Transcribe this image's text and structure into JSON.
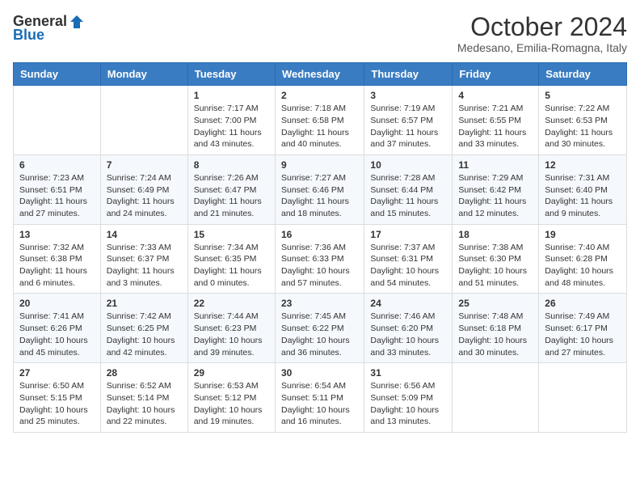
{
  "header": {
    "logo_general": "General",
    "logo_blue": "Blue",
    "month_title": "October 2024",
    "location": "Medesano, Emilia-Romagna, Italy"
  },
  "weekdays": [
    "Sunday",
    "Monday",
    "Tuesday",
    "Wednesday",
    "Thursday",
    "Friday",
    "Saturday"
  ],
  "weeks": [
    [
      {
        "day": "",
        "content": ""
      },
      {
        "day": "",
        "content": ""
      },
      {
        "day": "1",
        "content": "Sunrise: 7:17 AM\nSunset: 7:00 PM\nDaylight: 11 hours and 43 minutes."
      },
      {
        "day": "2",
        "content": "Sunrise: 7:18 AM\nSunset: 6:58 PM\nDaylight: 11 hours and 40 minutes."
      },
      {
        "day": "3",
        "content": "Sunrise: 7:19 AM\nSunset: 6:57 PM\nDaylight: 11 hours and 37 minutes."
      },
      {
        "day": "4",
        "content": "Sunrise: 7:21 AM\nSunset: 6:55 PM\nDaylight: 11 hours and 33 minutes."
      },
      {
        "day": "5",
        "content": "Sunrise: 7:22 AM\nSunset: 6:53 PM\nDaylight: 11 hours and 30 minutes."
      }
    ],
    [
      {
        "day": "6",
        "content": "Sunrise: 7:23 AM\nSunset: 6:51 PM\nDaylight: 11 hours and 27 minutes."
      },
      {
        "day": "7",
        "content": "Sunrise: 7:24 AM\nSunset: 6:49 PM\nDaylight: 11 hours and 24 minutes."
      },
      {
        "day": "8",
        "content": "Sunrise: 7:26 AM\nSunset: 6:47 PM\nDaylight: 11 hours and 21 minutes."
      },
      {
        "day": "9",
        "content": "Sunrise: 7:27 AM\nSunset: 6:46 PM\nDaylight: 11 hours and 18 minutes."
      },
      {
        "day": "10",
        "content": "Sunrise: 7:28 AM\nSunset: 6:44 PM\nDaylight: 11 hours and 15 minutes."
      },
      {
        "day": "11",
        "content": "Sunrise: 7:29 AM\nSunset: 6:42 PM\nDaylight: 11 hours and 12 minutes."
      },
      {
        "day": "12",
        "content": "Sunrise: 7:31 AM\nSunset: 6:40 PM\nDaylight: 11 hours and 9 minutes."
      }
    ],
    [
      {
        "day": "13",
        "content": "Sunrise: 7:32 AM\nSunset: 6:38 PM\nDaylight: 11 hours and 6 minutes."
      },
      {
        "day": "14",
        "content": "Sunrise: 7:33 AM\nSunset: 6:37 PM\nDaylight: 11 hours and 3 minutes."
      },
      {
        "day": "15",
        "content": "Sunrise: 7:34 AM\nSunset: 6:35 PM\nDaylight: 11 hours and 0 minutes."
      },
      {
        "day": "16",
        "content": "Sunrise: 7:36 AM\nSunset: 6:33 PM\nDaylight: 10 hours and 57 minutes."
      },
      {
        "day": "17",
        "content": "Sunrise: 7:37 AM\nSunset: 6:31 PM\nDaylight: 10 hours and 54 minutes."
      },
      {
        "day": "18",
        "content": "Sunrise: 7:38 AM\nSunset: 6:30 PM\nDaylight: 10 hours and 51 minutes."
      },
      {
        "day": "19",
        "content": "Sunrise: 7:40 AM\nSunset: 6:28 PM\nDaylight: 10 hours and 48 minutes."
      }
    ],
    [
      {
        "day": "20",
        "content": "Sunrise: 7:41 AM\nSunset: 6:26 PM\nDaylight: 10 hours and 45 minutes."
      },
      {
        "day": "21",
        "content": "Sunrise: 7:42 AM\nSunset: 6:25 PM\nDaylight: 10 hours and 42 minutes."
      },
      {
        "day": "22",
        "content": "Sunrise: 7:44 AM\nSunset: 6:23 PM\nDaylight: 10 hours and 39 minutes."
      },
      {
        "day": "23",
        "content": "Sunrise: 7:45 AM\nSunset: 6:22 PM\nDaylight: 10 hours and 36 minutes."
      },
      {
        "day": "24",
        "content": "Sunrise: 7:46 AM\nSunset: 6:20 PM\nDaylight: 10 hours and 33 minutes."
      },
      {
        "day": "25",
        "content": "Sunrise: 7:48 AM\nSunset: 6:18 PM\nDaylight: 10 hours and 30 minutes."
      },
      {
        "day": "26",
        "content": "Sunrise: 7:49 AM\nSunset: 6:17 PM\nDaylight: 10 hours and 27 minutes."
      }
    ],
    [
      {
        "day": "27",
        "content": "Sunrise: 6:50 AM\nSunset: 5:15 PM\nDaylight: 10 hours and 25 minutes."
      },
      {
        "day": "28",
        "content": "Sunrise: 6:52 AM\nSunset: 5:14 PM\nDaylight: 10 hours and 22 minutes."
      },
      {
        "day": "29",
        "content": "Sunrise: 6:53 AM\nSunset: 5:12 PM\nDaylight: 10 hours and 19 minutes."
      },
      {
        "day": "30",
        "content": "Sunrise: 6:54 AM\nSunset: 5:11 PM\nDaylight: 10 hours and 16 minutes."
      },
      {
        "day": "31",
        "content": "Sunrise: 6:56 AM\nSunset: 5:09 PM\nDaylight: 10 hours and 13 minutes."
      },
      {
        "day": "",
        "content": ""
      },
      {
        "day": "",
        "content": ""
      }
    ]
  ]
}
